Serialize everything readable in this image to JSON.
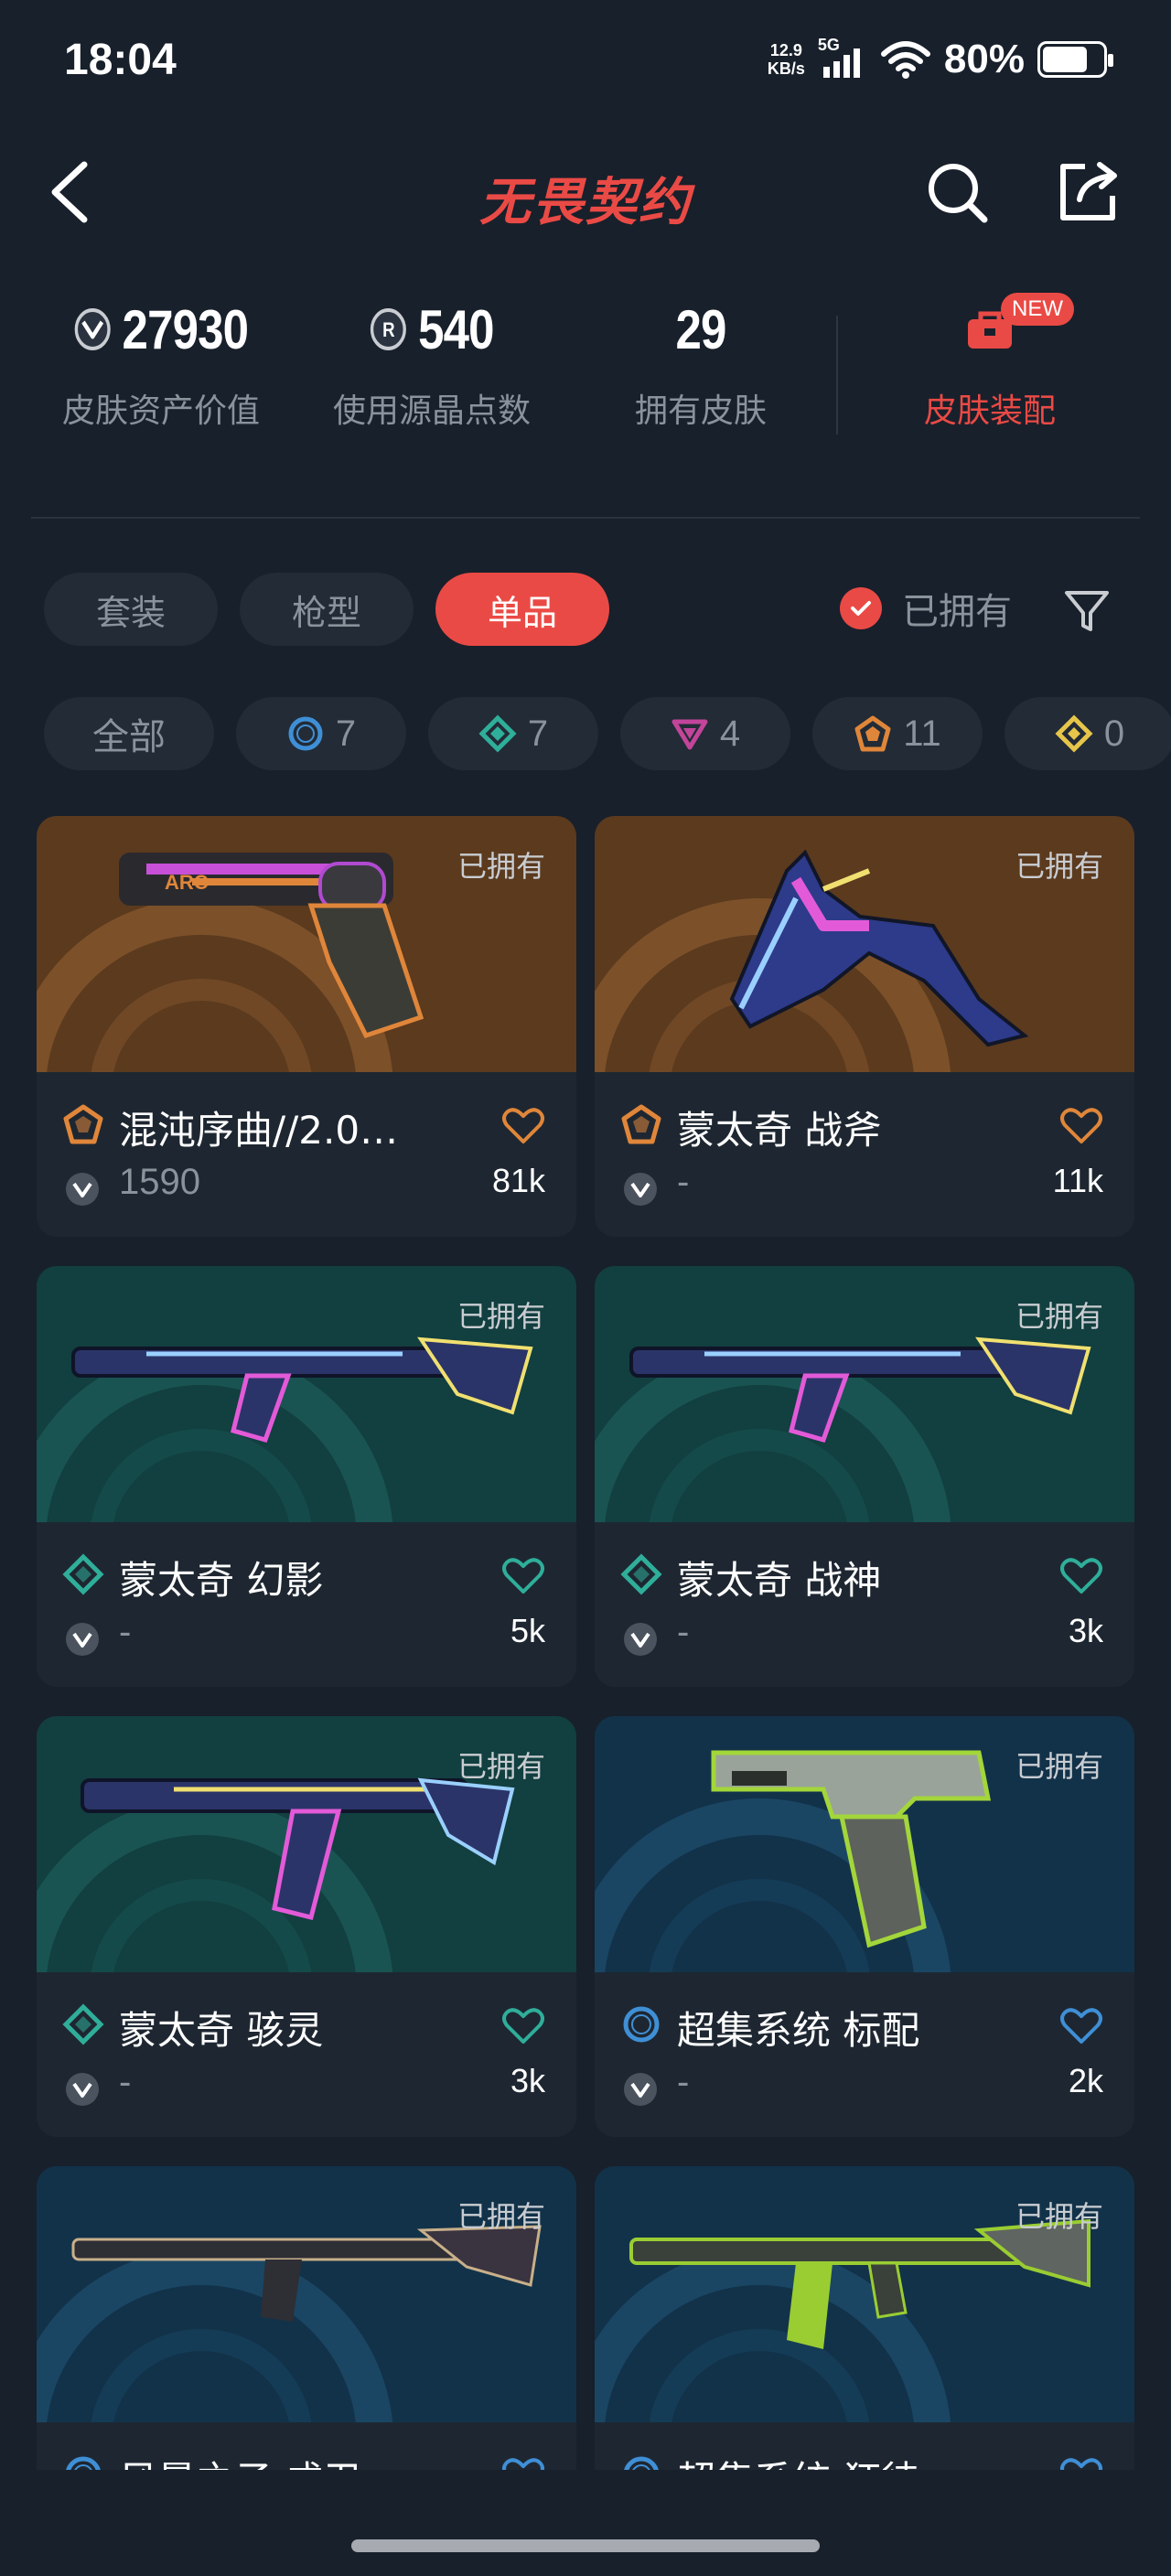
{
  "status_bar": {
    "time": "18:04",
    "net_speed_value": "12.9",
    "net_speed_unit": "KB/s",
    "network": "5G",
    "battery": "80%",
    "battery_level": 0.8
  },
  "header": {
    "title": "无畏契约"
  },
  "stats": [
    {
      "value": "27930",
      "label": "皮肤资产价值",
      "icon": "vp-currency-icon"
    },
    {
      "value": "540",
      "label": "使用源晶点数",
      "icon": "radianite-icon"
    },
    {
      "value": "29",
      "label": "拥有皮肤",
      "icon": ""
    }
  ],
  "loadout": {
    "label": "皮肤装配",
    "badge": "NEW"
  },
  "tabs": [
    {
      "label": "套装",
      "active": false
    },
    {
      "label": "枪型",
      "active": false
    },
    {
      "label": "单品",
      "active": true
    }
  ],
  "owned_filter": {
    "label": "已拥有",
    "checked": true
  },
  "rarity_filters": [
    {
      "label": "全部"
    },
    {
      "count": "7",
      "tier": "select",
      "color": "#3f8fd6"
    },
    {
      "count": "7",
      "tier": "deluxe",
      "color": "#2fae9a"
    },
    {
      "count": "4",
      "tier": "premium",
      "color": "#c3459a"
    },
    {
      "count": "11",
      "tier": "exclusive",
      "color": "#e0863a"
    },
    {
      "count": "0",
      "tier": "ultra",
      "color": "#e6c54a"
    }
  ],
  "cards": [
    {
      "owned": "已拥有",
      "name": "混沌序曲//2.0…",
      "price": "1590",
      "likes": "81k",
      "tier": "exclusive",
      "tier_color": "#e0863a",
      "bg": "orange",
      "weapon": "sheriff"
    },
    {
      "owned": "已拥有",
      "name": "蒙太奇 战斧",
      "price": "-",
      "likes": "11k",
      "tier": "exclusive",
      "tier_color": "#e0863a",
      "bg": "orange",
      "weapon": "axe"
    },
    {
      "owned": "已拥有",
      "name": "蒙太奇 幻影",
      "price": "-",
      "likes": "5k",
      "tier": "deluxe",
      "tier_color": "#2fae9a",
      "bg": "teal",
      "weapon": "rifle"
    },
    {
      "owned": "已拥有",
      "name": "蒙太奇 战神",
      "price": "-",
      "likes": "3k",
      "tier": "deluxe",
      "tier_color": "#2fae9a",
      "bg": "teal",
      "weapon": "rifle"
    },
    {
      "owned": "已拥有",
      "name": "蒙太奇 骇灵",
      "price": "-",
      "likes": "3k",
      "tier": "deluxe",
      "tier_color": "#2fae9a",
      "bg": "teal",
      "weapon": "smg"
    },
    {
      "owned": "已拥有",
      "name": "超集系统 标配",
      "price": "-",
      "likes": "2k",
      "tier": "select",
      "tier_color": "#3f8fd6",
      "bg": "blue",
      "weapon": "pistol"
    },
    {
      "owned": "已拥有",
      "name": "风暴之子 戍卫",
      "price": "-",
      "likes": "",
      "tier": "select",
      "tier_color": "#3f8fd6",
      "bg": "blue",
      "weapon": "rifle-dark"
    },
    {
      "owned": "已拥有",
      "name": "超集系统 狂徒",
      "price": "-",
      "likes": "",
      "tier": "select",
      "tier_color": "#3f8fd6",
      "bg": "blue",
      "weapon": "rifle-green"
    }
  ]
}
